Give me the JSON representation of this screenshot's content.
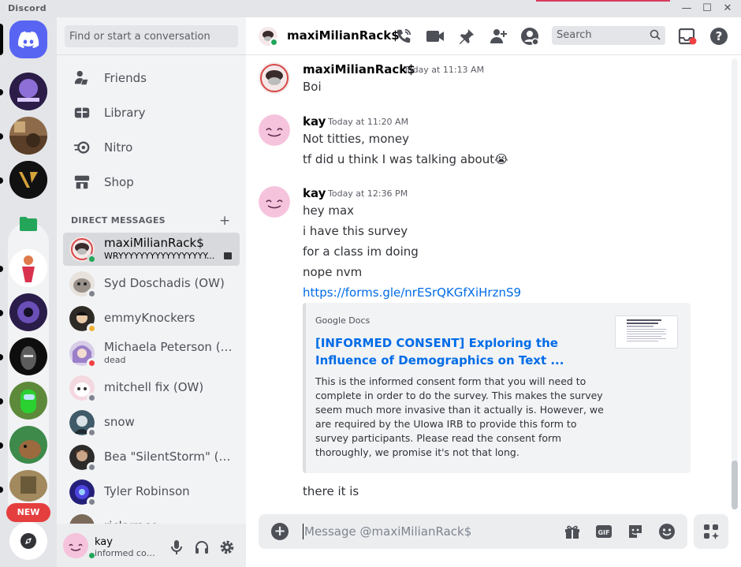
{
  "app": {
    "title": "Discord"
  },
  "window": {
    "minimize": "—",
    "maximize": "☐",
    "close": "✕"
  },
  "servers": {
    "new_badge": "NEW",
    "items": [
      {
        "name": "home",
        "icon": "discord-logo-icon"
      },
      {
        "name": "server-1",
        "icon": "server-avatar"
      },
      {
        "name": "server-2",
        "icon": "server-avatar"
      },
      {
        "name": "server-3",
        "icon": "server-avatar"
      },
      {
        "name": "folder",
        "icon": "folder-icon"
      },
      {
        "name": "server-5",
        "icon": "server-avatar"
      },
      {
        "name": "server-6",
        "icon": "server-avatar"
      },
      {
        "name": "server-7",
        "icon": "server-avatar"
      },
      {
        "name": "server-8",
        "icon": "server-avatar"
      },
      {
        "name": "server-9",
        "icon": "server-avatar"
      },
      {
        "name": "discover",
        "icon": "compass-icon"
      }
    ]
  },
  "sidebar": {
    "search_label": "Find or start a conversation",
    "nav": [
      {
        "label": "Friends",
        "icon": "friends-icon"
      },
      {
        "label": "Library",
        "icon": "library-icon"
      },
      {
        "label": "Nitro",
        "icon": "nitro-icon"
      },
      {
        "label": "Shop",
        "icon": "shop-icon"
      }
    ],
    "dm_header": "DIRECT MESSAGES",
    "dm_add": "+",
    "dms": [
      {
        "name": "maxiMilianRack$",
        "sub": "WRYYYYYYYYYYYYYYYYY...",
        "status": "online",
        "color": "#23a55a"
      },
      {
        "name": "Syd Doschadis (OW)",
        "sub": "",
        "status": "offline",
        "color": "#80848e"
      },
      {
        "name": "emmyKnockers",
        "sub": "",
        "status": "idle",
        "color": "#f0b232"
      },
      {
        "name": "Michaela Peterson (O...",
        "sub": "dead",
        "status": "dnd",
        "color": "#f23f43"
      },
      {
        "name": "mitchell fix (OW)",
        "sub": "",
        "status": "offline",
        "color": "#80848e"
      },
      {
        "name": "snow",
        "sub": "",
        "status": "offline",
        "color": "#80848e"
      },
      {
        "name": "Bea \"SilentStorm\" (OW)",
        "sub": "",
        "status": "offline",
        "color": "#80848e"
      },
      {
        "name": "Tyler Robinson",
        "sub": "",
        "status": "offline",
        "color": "#80848e"
      },
      {
        "name": "rickyrace",
        "sub": "",
        "status": "offline",
        "color": "#80848e"
      }
    ]
  },
  "user_panel": {
    "name": "kay",
    "status_text": "informed consent",
    "status_color": "#23a55a",
    "mic_icon": "microphone-icon",
    "headset_icon": "headphones-icon",
    "settings_icon": "gear-icon"
  },
  "chat": {
    "title": "maxiMilianRack$",
    "search_placeholder": "Search",
    "header_icons": [
      "phone-call-icon",
      "video-call-icon",
      "pin-icon",
      "add-friends-icon",
      "profile-icon",
      "inbox-icon",
      "help-icon"
    ],
    "messages": [
      {
        "author": "maxiMilianRack$",
        "time": "Today at 11:13 AM",
        "lines": [
          "Boi"
        ]
      },
      {
        "author": "kay",
        "time": "Today at 11:20 AM",
        "lines": [
          "Not titties, money",
          "tf did u think I was talking about😭"
        ]
      },
      {
        "author": "kay",
        "time": "Today at 12:36 PM",
        "lines": [
          "hey max",
          "i have this survey",
          "for a class im doing",
          "nope nvm"
        ],
        "link": "https://forms.gle/nrESrQKGfXiHrznS9",
        "embed": {
          "provider": "Google Docs",
          "title": "[INFORMED CONSENT] Exploring the Influence of Demographics on Text ...",
          "description": "This is the informed consent form that you will need to complete in order to do the survey. This makes the survey seem much more invasive than it actually is. However, we are required by the UIowa IRB to provide this form to survey participants. Please read the consent form thoroughly, we promise it's not that long."
        },
        "after": "there it is"
      }
    ],
    "composer_placeholder": "Message @maxiMilianRack$",
    "composer_icons": [
      "gift-icon",
      "gif-icon",
      "sticker-icon",
      "emoji-icon"
    ],
    "gif_label": "GIF",
    "apps_icon": "apps-icon"
  }
}
